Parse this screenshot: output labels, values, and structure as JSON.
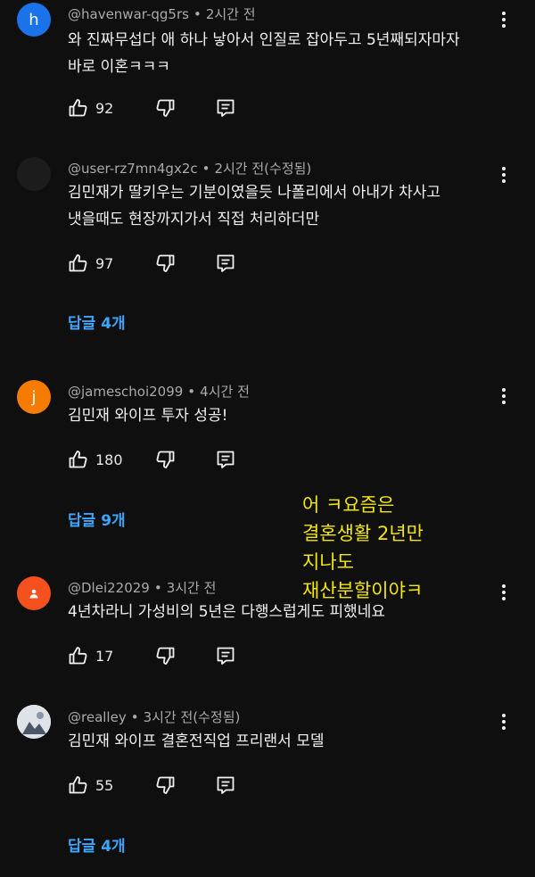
{
  "comments": [
    {
      "avatar_letter": "h",
      "avatar_color": "#1a73e8",
      "username": "@havenwar-qg5rs",
      "time": "2시간 전",
      "text": "와 진짜무섭다 애 하나 낳아서 인질로 잡아두고 5년째되자마자\n바로 이혼ㅋㅋㅋ",
      "likes": "92"
    },
    {
      "avatar_color": "#1c1c1c",
      "username": "@user-rz7mn4gx2c",
      "time": "2시간 전(수정됨)",
      "text": "김민재가 딸키우는 기분이였을듯 나폴리에서 아내가 차사고\n냇을때도 현장까지가서  직접 처리하더만",
      "likes": "97",
      "replies": "답글 4개"
    },
    {
      "avatar_letter": "j",
      "avatar_color": "#f57c00",
      "username": "@jameschoi2099",
      "time": "4시간 전",
      "text": "김민재 와이프 투자 성공!",
      "likes": "180",
      "replies": "답글 9개"
    },
    {
      "avatar_color": "#f4511e",
      "username": "@Dlei22029",
      "time": "3시간 전",
      "text": "4년차라니 가성비의 5년은 다행스럽게도 피했네요",
      "likes": "17"
    },
    {
      "avatar_color": "#e8eaed",
      "username": "@realley",
      "time": "3시간 전(수정됨)",
      "text": "김민재 와이프 결혼전직업 프리랜서 모델",
      "likes": "55",
      "replies": "답글 4개"
    }
  ],
  "overlay": {
    "lines": [
      "어 ㅋ요즘은",
      "결혼생활 2년만",
      "지나도",
      "재산분할이야ㅋ"
    ],
    "color": "#f3e60a"
  }
}
